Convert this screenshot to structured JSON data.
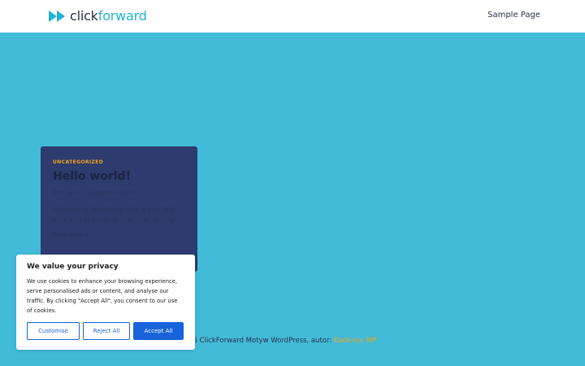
{
  "header": {
    "logo_part1": "click",
    "logo_part2": "forward",
    "logo_icon": "double-chevron-icon",
    "nav_link": "Sample Page"
  },
  "post": {
    "category": "UNCATEGORIZED",
    "title": "Hello world!",
    "meta": "Post autor · 12 stycznia 2026",
    "excerpt": "Welcome to WordPress. This is your first post. Edit or delete it, then start writing!",
    "more": "Read more »"
  },
  "footer": {
    "text": "© 2026 ClickForward Motyw WordPress, autor:",
    "link": "Kadence WP"
  },
  "cookie": {
    "title": "We value your privacy",
    "text": "We use cookies to enhance your browsing experience, serve personalised ads or content, and analyse our traffic. By clicking \"Accept All\", you consent to our use of cookies.",
    "customise": "Customise",
    "reject": "Reject All",
    "accept": "Accept All"
  },
  "colors": {
    "background": "#42bbd9",
    "card": "#2d3b6e",
    "accent": "#f0a41c",
    "button_blue": "#1863dc",
    "logo_cyan": "#22b2d6"
  }
}
